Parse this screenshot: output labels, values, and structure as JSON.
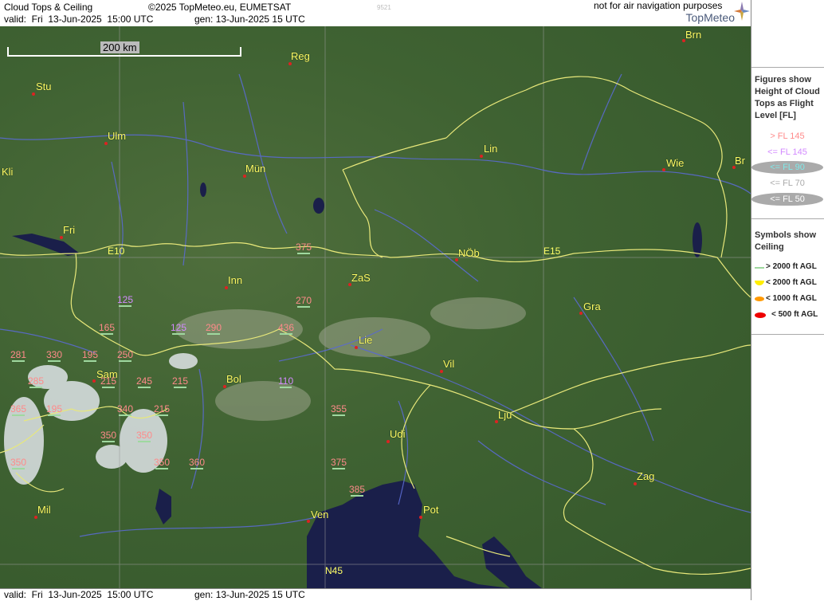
{
  "header": {
    "title": "Cloud Tops & Ceiling",
    "copyright": "©2025 TopMeteo.eu, EUMETSAT",
    "valid": "valid:  Fri  13-Jun-2025  15:00 UTC",
    "gen": "gen: 13-Jun-2025 15 UTC",
    "stamp": "9521",
    "brand": "TopMeteo"
  },
  "footer": {
    "valid": "valid:  Fri  13-Jun-2025  15:00 UTC",
    "gen": "gen: 13-Jun-2025 15 UTC",
    "disclaimer": "not for air navigation purposes"
  },
  "scale": {
    "label": "200 km"
  },
  "cities": [
    {
      "name": "Brn"
    },
    {
      "name": "Reg"
    },
    {
      "name": "Stu"
    },
    {
      "name": "Ulm"
    },
    {
      "name": "Lin"
    },
    {
      "name": "Wie"
    },
    {
      "name": "Br"
    },
    {
      "name": "Kli"
    },
    {
      "name": "Mün"
    },
    {
      "name": "Fri"
    },
    {
      "name": "NÖb"
    },
    {
      "name": "ZaS"
    },
    {
      "name": "Inn"
    },
    {
      "name": "Gra"
    },
    {
      "name": "Lie"
    },
    {
      "name": "Vil"
    },
    {
      "name": "Sam"
    },
    {
      "name": "Bol"
    },
    {
      "name": "Lju"
    },
    {
      "name": "Udi"
    },
    {
      "name": "Zag"
    },
    {
      "name": "Mil"
    },
    {
      "name": "Ven"
    },
    {
      "name": "Pot"
    }
  ],
  "grid_labels": [
    "E10",
    "E15",
    "N45"
  ],
  "flight_levels": [
    {
      "value": "375",
      "category": "pink"
    },
    {
      "value": "125",
      "category": "violet"
    },
    {
      "value": "270",
      "category": "pink"
    },
    {
      "value": "165",
      "category": "pink"
    },
    {
      "value": "125",
      "category": "violet"
    },
    {
      "value": "290",
      "category": "pink"
    },
    {
      "value": "436",
      "category": "pink"
    },
    {
      "value": "281",
      "category": "pink"
    },
    {
      "value": "330",
      "category": "pink"
    },
    {
      "value": "195",
      "category": "pink"
    },
    {
      "value": "250",
      "category": "pink"
    },
    {
      "value": "285",
      "category": "pink"
    },
    {
      "value": "215",
      "category": "pink"
    },
    {
      "value": "245",
      "category": "pink"
    },
    {
      "value": "215",
      "category": "pink"
    },
    {
      "value": "110",
      "category": "violet"
    },
    {
      "value": "365",
      "category": "pink"
    },
    {
      "value": "195",
      "category": "pink"
    },
    {
      "value": "340",
      "category": "pink"
    },
    {
      "value": "215",
      "category": "pink"
    },
    {
      "value": "355",
      "category": "pink"
    },
    {
      "value": "350",
      "category": "pink"
    },
    {
      "value": "350",
      "category": "pink"
    },
    {
      "value": "360",
      "category": "pink"
    },
    {
      "value": "375",
      "category": "pink"
    },
    {
      "value": "385",
      "category": "pink"
    },
    {
      "value": "350",
      "category": "pink"
    },
    {
      "value": "350",
      "category": "pink"
    }
  ],
  "legend": {
    "tops_title": "Figures show Height of Cloud Tops as Flight Level  [FL]",
    "tops_items": [
      {
        "label": "> FL 145",
        "color": "#ff8a8a"
      },
      {
        "label": "<= FL 145",
        "color": "#d38aff"
      },
      {
        "label": "<= FL 90",
        "color": "#7fe8e8"
      },
      {
        "label": "<= FL 70",
        "color": "#aaaaaa"
      },
      {
        "label": "<= FL 50",
        "color": "#ffffff"
      }
    ],
    "ceiling_title": "Symbols show Ceiling",
    "ceiling_items": [
      {
        "label": "> 2000 ft AGL",
        "color": "#9fd89f"
      },
      {
        "label": "< 2000 ft AGL",
        "color": "#ffee00"
      },
      {
        "label": "< 1000 ft AGL",
        "color": "#ff9900"
      },
      {
        "label": "< 500 ft AGL",
        "color": "#ee0000"
      }
    ]
  }
}
